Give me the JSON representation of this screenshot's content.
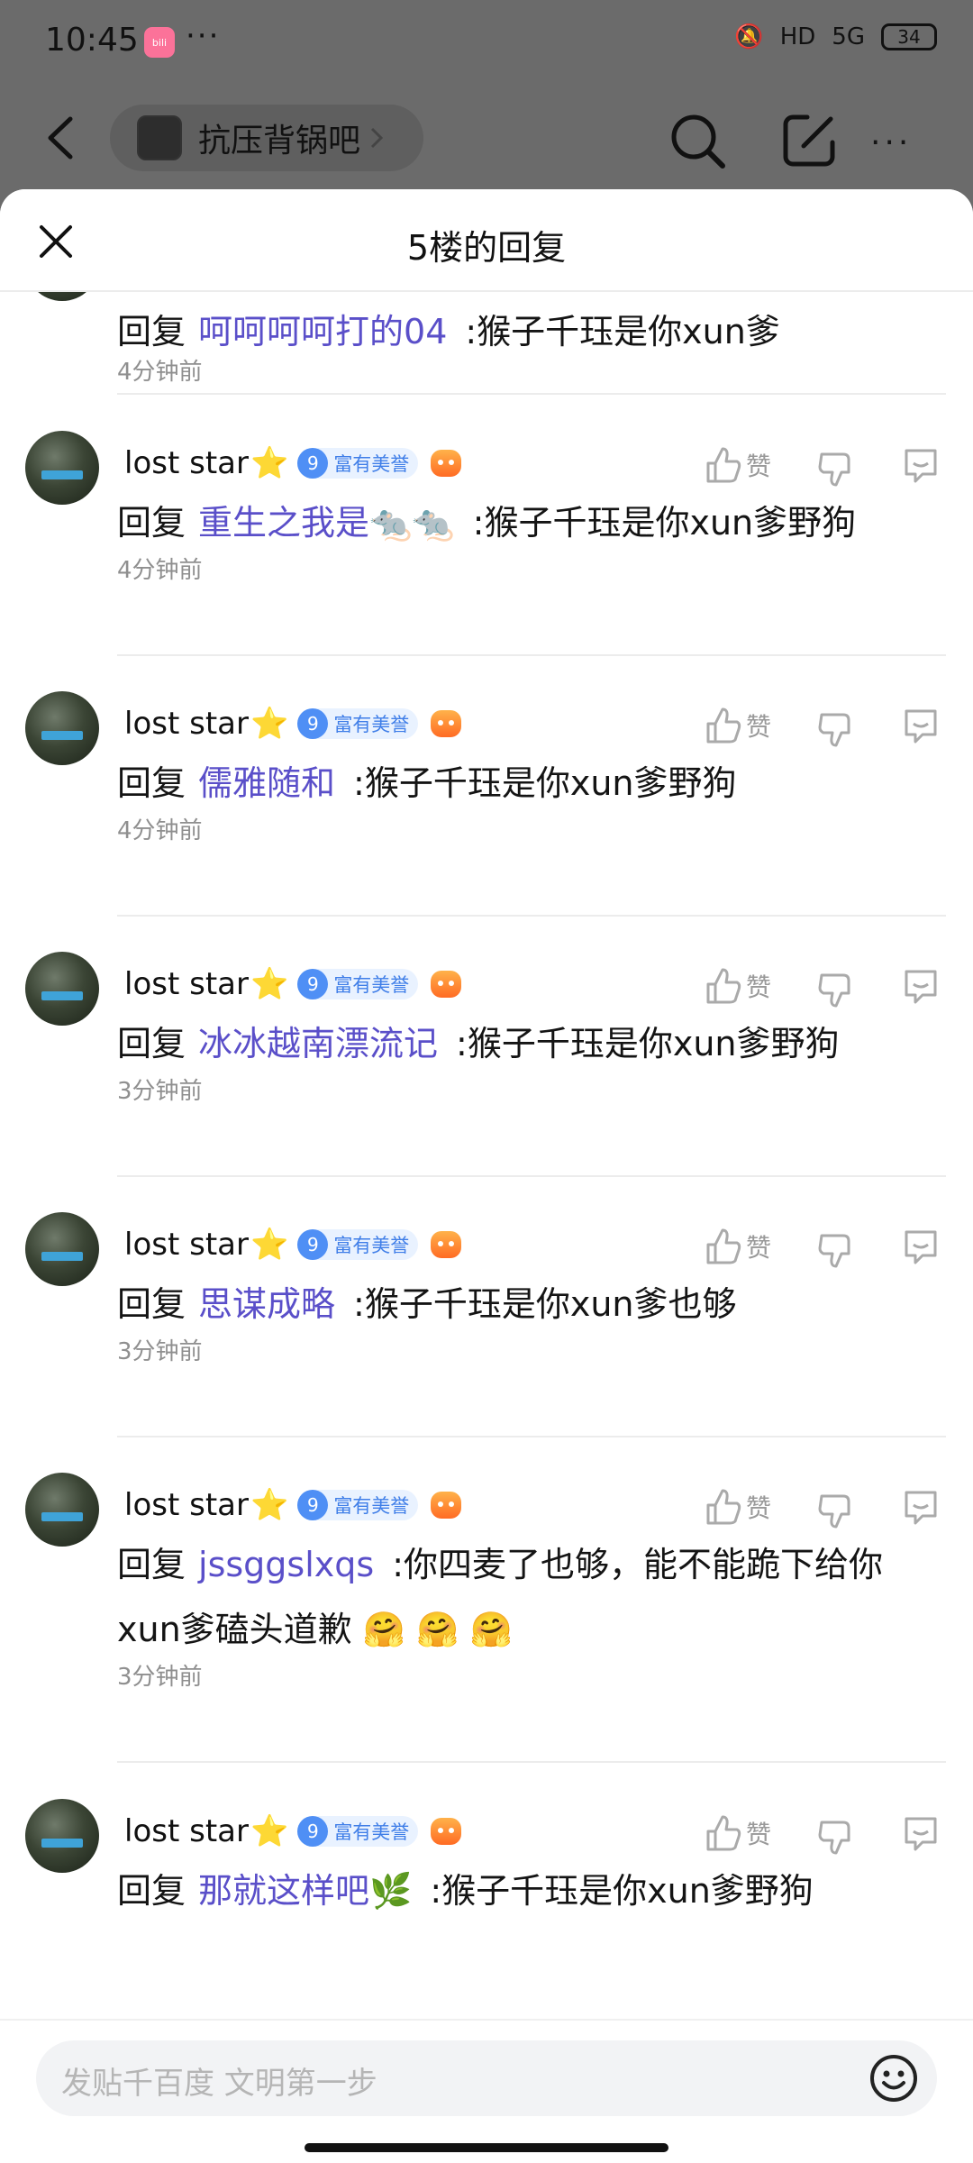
{
  "status": {
    "time": "10:45",
    "battery": "34",
    "network": "5G"
  },
  "nav": {
    "forum_name": "抗压背锅吧"
  },
  "sheet": {
    "title": "5楼的回复"
  },
  "comments": [
    {
      "user": "",
      "reply_kw": "回复",
      "target": "呵呵呵呵打的04",
      "text": ":猴子千珏是你xun爹",
      "text2": "",
      "time": "4分钟前"
    },
    {
      "user": "lost star",
      "badge_level": "9",
      "badge_text": "富有美誉",
      "like_label": "赞",
      "reply_kw": "回复",
      "target": "重生之我是🐀🐀",
      "text": ":猴子千珏是你xun爹野狗",
      "text2": "",
      "time": "4分钟前"
    },
    {
      "user": "lost star",
      "badge_level": "9",
      "badge_text": "富有美誉",
      "like_label": "赞",
      "reply_kw": "回复",
      "target": "儒雅随和",
      "text": ":猴子千珏是你xun爹野狗",
      "text2": "",
      "time": "4分钟前"
    },
    {
      "user": "lost star",
      "badge_level": "9",
      "badge_text": "富有美誉",
      "like_label": "赞",
      "reply_kw": "回复",
      "target": "冰冰越南漂流记",
      "text": ":猴子千珏是你xun爹野狗",
      "text2": "",
      "time": "3分钟前"
    },
    {
      "user": "lost star",
      "badge_level": "9",
      "badge_text": "富有美誉",
      "like_label": "赞",
      "reply_kw": "回复",
      "target": "思谋成略",
      "text": ":猴子千珏是你xun爹也够",
      "text2": "",
      "time": "3分钟前"
    },
    {
      "user": "lost star",
      "badge_level": "9",
      "badge_text": "富有美誉",
      "like_label": "赞",
      "reply_kw": "回复",
      "target": "jssggslxqs",
      "text": ":你四麦了也够，能不能跪下给你",
      "text2": "xun爹磕头道歉 🤗 🤗 🤗",
      "time": "3分钟前"
    },
    {
      "user": "lost star",
      "badge_level": "9",
      "badge_text": "富有美誉",
      "like_label": "赞",
      "reply_kw": "回复",
      "target": "那就这样吧🌿",
      "text": ":猴子千珏是你xun爹野狗",
      "text2": "",
      "time": ""
    }
  ],
  "composer": {
    "placeholder": "发贴千百度 文明第一步"
  }
}
